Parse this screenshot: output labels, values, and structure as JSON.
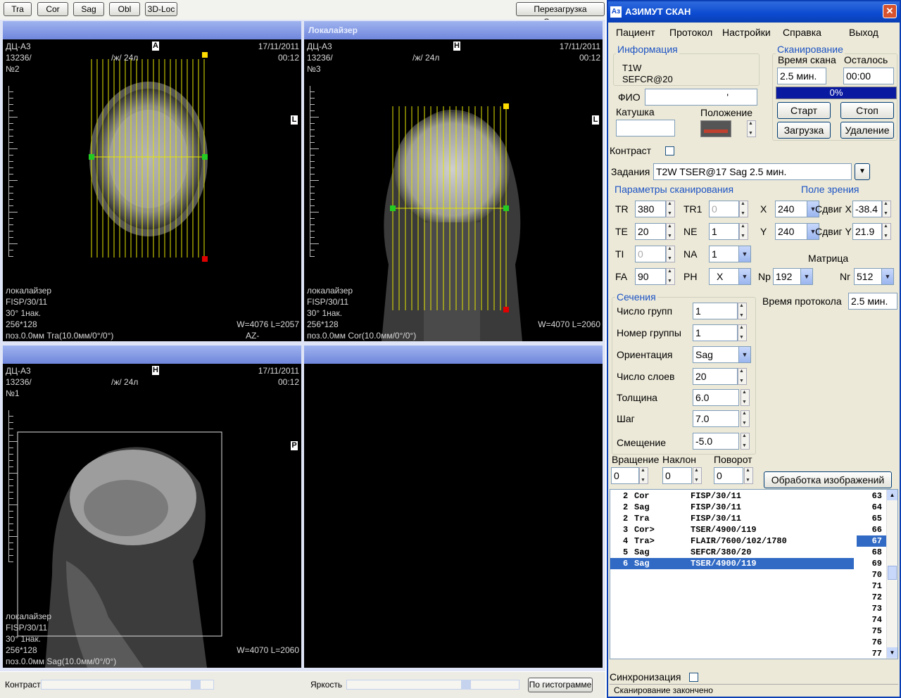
{
  "toolbar": {
    "tra": "Tra",
    "cor": "Cor",
    "sag": "Sag",
    "obl": "Obl",
    "loc3d": "3D-Loc",
    "restart": "Перезагрузка Сервера"
  },
  "viewports": {
    "v1": {
      "header": "",
      "name": "ДЦ-А3",
      "id": "13236/",
      "pat": "/ж/ 24л",
      "num": "№2",
      "date": "17/11/2011",
      "time": "00:12",
      "top_marker": "A",
      "side_marker": "L",
      "l1": "локалайзер",
      "l2": "FISP/30/11",
      "l3": "30° 1нак.",
      "l4": "256*128",
      "l5": "поз.0.0мм Tra(10.0мм/0°/0°)",
      "wl": "W=4076 L=2057",
      "az": "AZ-"
    },
    "v2": {
      "header": "Локалайзер",
      "name": "ДЦ-А3",
      "id": "13236/",
      "pat": "/ж/ 24л",
      "num": "№3",
      "date": "17/11/2011",
      "time": "00:12",
      "top_marker": "H",
      "side_marker": "L",
      "l1": "локалайзер",
      "l2": "FISP/30/11",
      "l3": "30° 1нак.",
      "l4": "256*128",
      "l5": "поз.0.0мм Cor(10.0мм/0°/0°)",
      "wl": "W=4070 L=2060"
    },
    "v3": {
      "header": "",
      "name": "ДЦ-А3",
      "id": "13236/",
      "pat": "/ж/ 24л",
      "num": "№1",
      "date": "17/11/2011",
      "time": "00:12",
      "top_marker": "H",
      "side_marker": "P",
      "l1": "локалайзер",
      "l2": "FISP/30/11",
      "l3": "30° 1нак.",
      "l4": "256*128",
      "l5": "поз.0.0мм Sag(10.0мм/0°/0°)",
      "wl": "W=4070 L=2060"
    },
    "v4": {
      "header": ""
    }
  },
  "bottom": {
    "contrast": "Контраст",
    "brightness": "Яркость",
    "histogram": "По гистограмме"
  },
  "window": {
    "title": "АЗИМУТ СКАН",
    "icon": "Аз",
    "close": "✕"
  },
  "menu": {
    "patient": "Пациент",
    "protocol": "Протокол",
    "settings": "Настройки",
    "help": "Справка",
    "exit": "Выход"
  },
  "info": {
    "title": "Информация",
    "line1": "T1W",
    "line2": "SEFCR@20",
    "fio_label": "ФИО",
    "fio_value": "'",
    "coil_label": "Катушка",
    "position_label": "Положение"
  },
  "scan": {
    "title": "Сканирование",
    "time_label": "Время скана",
    "remaining_label": "Осталось",
    "time_value": "2.5 мин.",
    "remaining_value": "00:00",
    "progress": "0%",
    "progress_fraction": 0,
    "start": "Старт",
    "stop": "Стоп",
    "load": "Загрузка",
    "delete": "Удаление"
  },
  "contrast_label": "Контраст",
  "task": {
    "label": "Задания",
    "value": "T2W TSER@17  Sag  2.5 мин."
  },
  "params": {
    "title": "Параметры сканирования",
    "fov_title": "Поле зрения",
    "tr_l": "TR",
    "tr": "380",
    "tr1_l": "TR1",
    "tr1": "0",
    "x_l": "X",
    "x": "240",
    "shiftx_l": "Сдвиг X",
    "shiftx": "-38.4",
    "te_l": "TE",
    "te": "20",
    "ne_l": "NE",
    "ne": "1",
    "y_l": "Y",
    "y": "240",
    "shifty_l": "Сдвиг Y",
    "shifty": "21.9",
    "ti_l": "TI",
    "ti": "0",
    "na_l": "NA",
    "na": "1",
    "matrix_l": "Матрица",
    "fa_l": "FA",
    "fa": "90",
    "ph_l": "PH",
    "ph": "X",
    "np_l": "Np",
    "np": "192",
    "nr_l": "Nr",
    "nr": "512"
  },
  "sections": {
    "title": "Сечения",
    "groups_l": "Число групп",
    "groups": "1",
    "groupnum_l": "Номер группы",
    "groupnum": "1",
    "orient_l": "Ориентация",
    "orient": "Sag",
    "slices_l": "Число слоев",
    "slices": "20",
    "thick_l": "Толщина",
    "thick": "6.0",
    "step_l": "Шаг",
    "step": "7.0",
    "offset_l": "Смещение",
    "offset": "-5.0",
    "rot_l": "Вращение",
    "rot": "0",
    "tilt_l": "Наклон",
    "tilt": "0",
    "turn_l": "Поворот",
    "turn": "0",
    "proto_time_l": "Время протокола",
    "proto_time": "2.5 мин.",
    "process": "Обработка изображений"
  },
  "protocols": [
    {
      "n": "2",
      "o": "Cor",
      "s": "FISP/30/11"
    },
    {
      "n": "2",
      "o": "Sag",
      "s": "FISP/30/11"
    },
    {
      "n": "2",
      "o": "Tra",
      "s": "FISP/30/11"
    },
    {
      "n": "3",
      "o": "Cor>",
      "s": "TSER/4900/119"
    },
    {
      "n": "4",
      "o": "Tra>",
      "s": "FLAIR/7600/102/1780"
    },
    {
      "n": "5",
      "o": "Sag",
      "s": "SEFCR/380/20"
    },
    {
      "n": "6",
      "o": "Sag",
      "s": "TSER/4900/119"
    }
  ],
  "numbers": [
    "63",
    "64",
    "65",
    "66",
    "67",
    "68",
    "69",
    "70",
    "71",
    "72",
    "73",
    "74",
    "75",
    "76",
    "77"
  ],
  "sync_label": "Синхронизация",
  "status": "Сканирование закончено"
}
